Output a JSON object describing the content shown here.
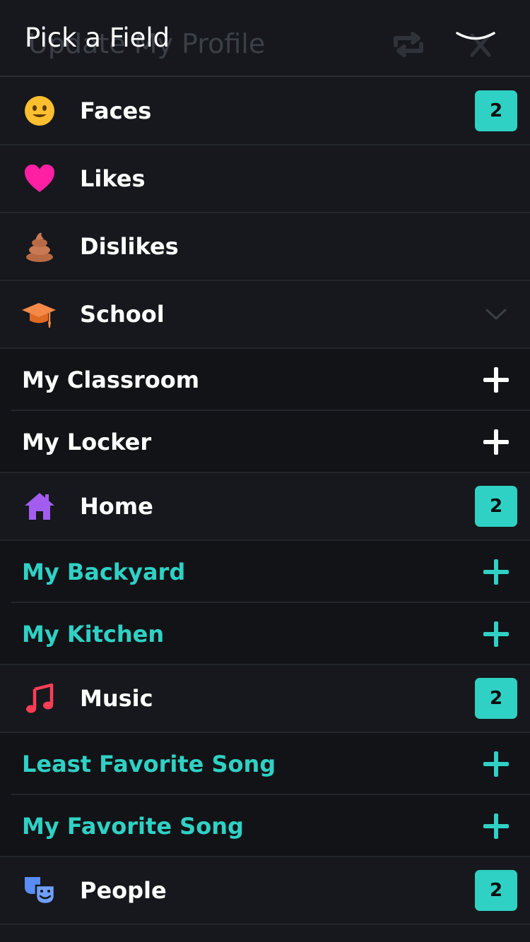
{
  "header": {
    "title": "Pick a Field",
    "background_title": "Update My Profile"
  },
  "colors": {
    "background": "#16181d",
    "accent": "#2fd1c4",
    "badge_text": "#0b0d10"
  },
  "sections": [
    {
      "id": "faces",
      "label": "Faces",
      "icon": "smiley-face-icon",
      "badge": "2"
    },
    {
      "id": "likes",
      "label": "Likes",
      "icon": "heart-icon"
    },
    {
      "id": "dislikes",
      "label": "Dislikes",
      "icon": "poop-icon"
    },
    {
      "id": "school",
      "label": "School",
      "icon": "graduation-cap-icon",
      "expanded": true,
      "items": [
        {
          "label": "My Classroom",
          "style": "white"
        },
        {
          "label": "My Locker",
          "style": "white"
        }
      ]
    },
    {
      "id": "home",
      "label": "Home",
      "icon": "house-icon",
      "badge": "2",
      "items": [
        {
          "label": "My Backyard",
          "style": "teal"
        },
        {
          "label": "My Kitchen",
          "style": "teal"
        }
      ]
    },
    {
      "id": "music",
      "label": "Music",
      "icon": "music-note-icon",
      "badge": "2",
      "items": [
        {
          "label": "Least Favorite Song",
          "style": "teal"
        },
        {
          "label": "My Favorite Song",
          "style": "teal"
        }
      ]
    },
    {
      "id": "people",
      "label": "People",
      "icon": "people-masks-icon",
      "badge": "2"
    }
  ]
}
